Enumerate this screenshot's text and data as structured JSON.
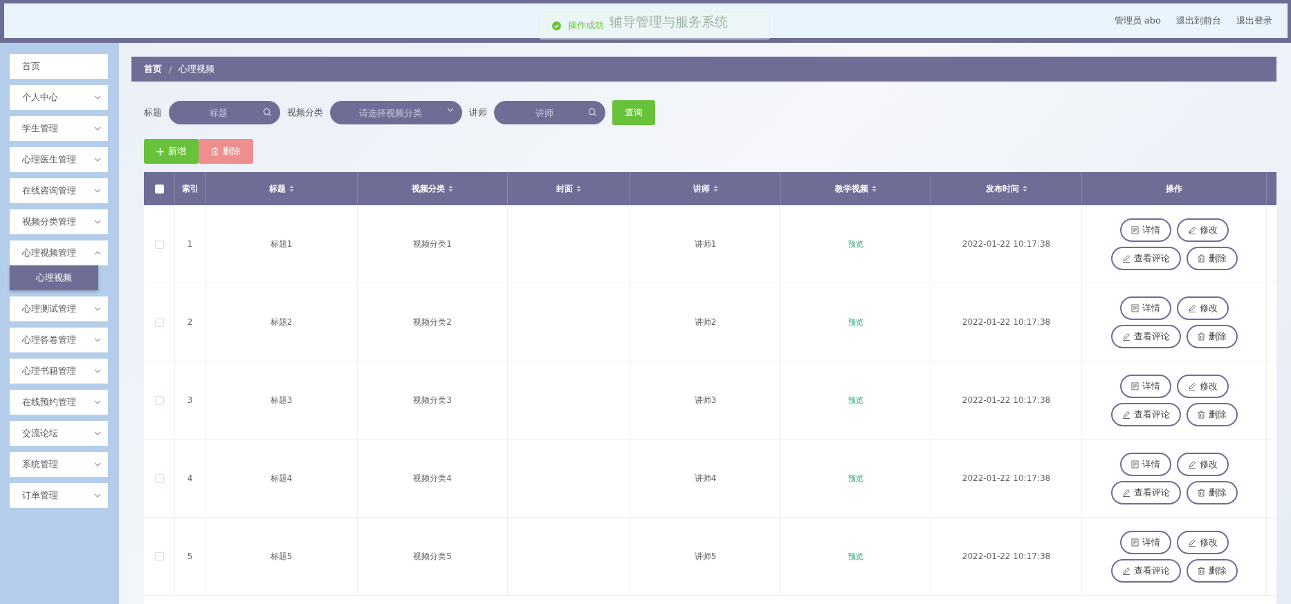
{
  "header": {
    "title": "辅导管理与服务系统",
    "user": "管理员 abo",
    "links": [
      "退出到前台",
      "退出登录"
    ]
  },
  "toast": {
    "message": "操作成功"
  },
  "sidebar": {
    "items": [
      {
        "label": "首页",
        "kind": "link"
      },
      {
        "label": "个人中心",
        "kind": "menu",
        "expanded": false
      },
      {
        "label": "学生管理",
        "kind": "menu",
        "expanded": false
      },
      {
        "label": "心理医生管理",
        "kind": "menu",
        "expanded": false
      },
      {
        "label": "在线咨询管理",
        "kind": "menu",
        "expanded": false
      },
      {
        "label": "视频分类管理",
        "kind": "menu",
        "expanded": false
      },
      {
        "label": "心理视频管理",
        "kind": "menu",
        "expanded": true,
        "children": [
          {
            "label": "心理视频",
            "selected": true
          }
        ]
      },
      {
        "label": "心理测试管理",
        "kind": "menu",
        "expanded": false
      },
      {
        "label": "心理答卷管理",
        "kind": "menu",
        "expanded": false
      },
      {
        "label": "心理书籍管理",
        "kind": "menu",
        "expanded": false
      },
      {
        "label": "在线预约管理",
        "kind": "menu",
        "expanded": false
      },
      {
        "label": "交流论坛",
        "kind": "menu",
        "expanded": false
      },
      {
        "label": "系统管理",
        "kind": "menu",
        "expanded": false
      },
      {
        "label": "订单管理",
        "kind": "menu",
        "expanded": false
      }
    ]
  },
  "breadcrumb": {
    "separator": "/",
    "items": [
      "首页",
      "心理视频"
    ]
  },
  "filters": [
    {
      "kind": "input",
      "label": "标题",
      "placeholder": "标题"
    },
    {
      "kind": "select",
      "label": "视频分类",
      "placeholder": "请选择视频分类"
    },
    {
      "kind": "input",
      "label": "讲师",
      "placeholder": "讲师"
    }
  ],
  "search_button": "查询",
  "actions": [
    {
      "kind": "add",
      "label": "新增"
    },
    {
      "kind": "delete",
      "label": "删除",
      "disabled": true
    }
  ],
  "table": {
    "select_all_checked": false,
    "columns": [
      {
        "label": "索引",
        "sortable": false
      },
      {
        "label": "标题",
        "sortable": true
      },
      {
        "label": "视频分类",
        "sortable": true
      },
      {
        "label": "封面",
        "sortable": true
      },
      {
        "label": "讲师",
        "sortable": true
      },
      {
        "label": "教学视频",
        "sortable": true
      },
      {
        "label": "发布时间",
        "sortable": true
      },
      {
        "label": "操作",
        "sortable": false
      }
    ],
    "rows": [
      {
        "checked": false,
        "index": "1",
        "title": "标题1",
        "category": "视频分类1",
        "teacher": "讲师1",
        "video": "预览",
        "time": "2022-01-22 10:17:38",
        "actions": [
          {
            "kind": "detail",
            "label": "详情"
          },
          {
            "kind": "edit",
            "label": "修改"
          },
          {
            "kind": "comment",
            "label": "查看评论"
          },
          {
            "kind": "delete",
            "label": "删除"
          }
        ]
      },
      {
        "checked": false,
        "index": "2",
        "title": "标题2",
        "category": "视频分类2",
        "teacher": "讲师2",
        "video": "预览",
        "time": "2022-01-22 10:17:38",
        "actions": [
          {
            "kind": "detail",
            "label": "详情"
          },
          {
            "kind": "edit",
            "label": "修改"
          },
          {
            "kind": "comment",
            "label": "查看评论"
          },
          {
            "kind": "delete",
            "label": "删除"
          }
        ]
      },
      {
        "checked": false,
        "index": "3",
        "title": "标题3",
        "category": "视频分类3",
        "teacher": "讲师3",
        "video": "预览",
        "time": "2022-01-22 10:17:38",
        "actions": [
          {
            "kind": "detail",
            "label": "详情"
          },
          {
            "kind": "edit",
            "label": "修改"
          },
          {
            "kind": "comment",
            "label": "查看评论"
          },
          {
            "kind": "delete",
            "label": "删除"
          }
        ]
      },
      {
        "checked": false,
        "index": "4",
        "title": "标题4",
        "category": "视频分类4",
        "teacher": "讲师4",
        "video": "预览",
        "time": "2022-01-22 10:17:38",
        "actions": [
          {
            "kind": "detail",
            "label": "详情"
          },
          {
            "kind": "edit",
            "label": "修改"
          },
          {
            "kind": "comment",
            "label": "查看评论"
          },
          {
            "kind": "delete",
            "label": "删除"
          }
        ]
      },
      {
        "checked": false,
        "index": "5",
        "title": "标题5",
        "category": "视频分类5",
        "teacher": "讲师5",
        "video": "预览",
        "time": "2022-01-22 10:17:38",
        "actions": [
          {
            "kind": "detail",
            "label": "详情"
          },
          {
            "kind": "edit",
            "label": "修改"
          },
          {
            "kind": "comment",
            "label": "查看评论"
          },
          {
            "kind": "delete",
            "label": "删除"
          }
        ]
      }
    ]
  }
}
